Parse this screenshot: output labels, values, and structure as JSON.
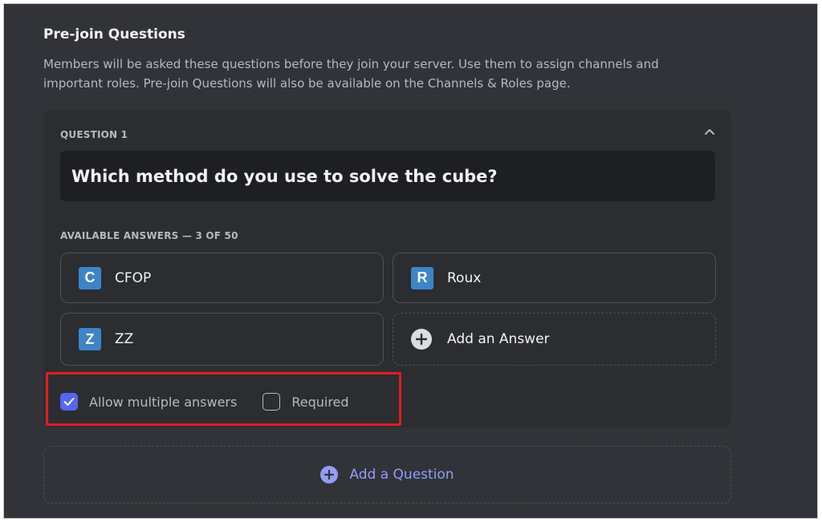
{
  "section": {
    "title": "Pre-join Questions",
    "description": "Members will be asked these questions before they join your server. Use them to assign channels and important roles. Pre-join Questions will also be available on the Channels & Roles page."
  },
  "question": {
    "label": "QUESTION 1",
    "text": "Which method do you use to solve the cube?",
    "answers_label": "AVAILABLE ANSWERS — 3 OF 50",
    "answers": [
      {
        "letter": "C",
        "label": "CFOP"
      },
      {
        "letter": "R",
        "label": "Roux"
      },
      {
        "letter": "Z",
        "label": "ZZ"
      }
    ],
    "add_answer_label": "Add an Answer",
    "options": {
      "allow_multiple": {
        "label": "Allow multiple answers",
        "checked": true
      },
      "required": {
        "label": "Required",
        "checked": false
      }
    }
  },
  "add_question_label": "Add a Question",
  "colors": {
    "background": "#313338",
    "card": "#2b2d31",
    "accent": "#5865f2",
    "link": "#949cf7",
    "highlight": "#e01e1e",
    "letter_icon": "#3d85c6"
  },
  "icons": {
    "collapse": "chevron-up-icon",
    "add_answer": "plus-circle-icon",
    "add_question": "plus-circle-icon",
    "checked": "checkmark-icon"
  }
}
